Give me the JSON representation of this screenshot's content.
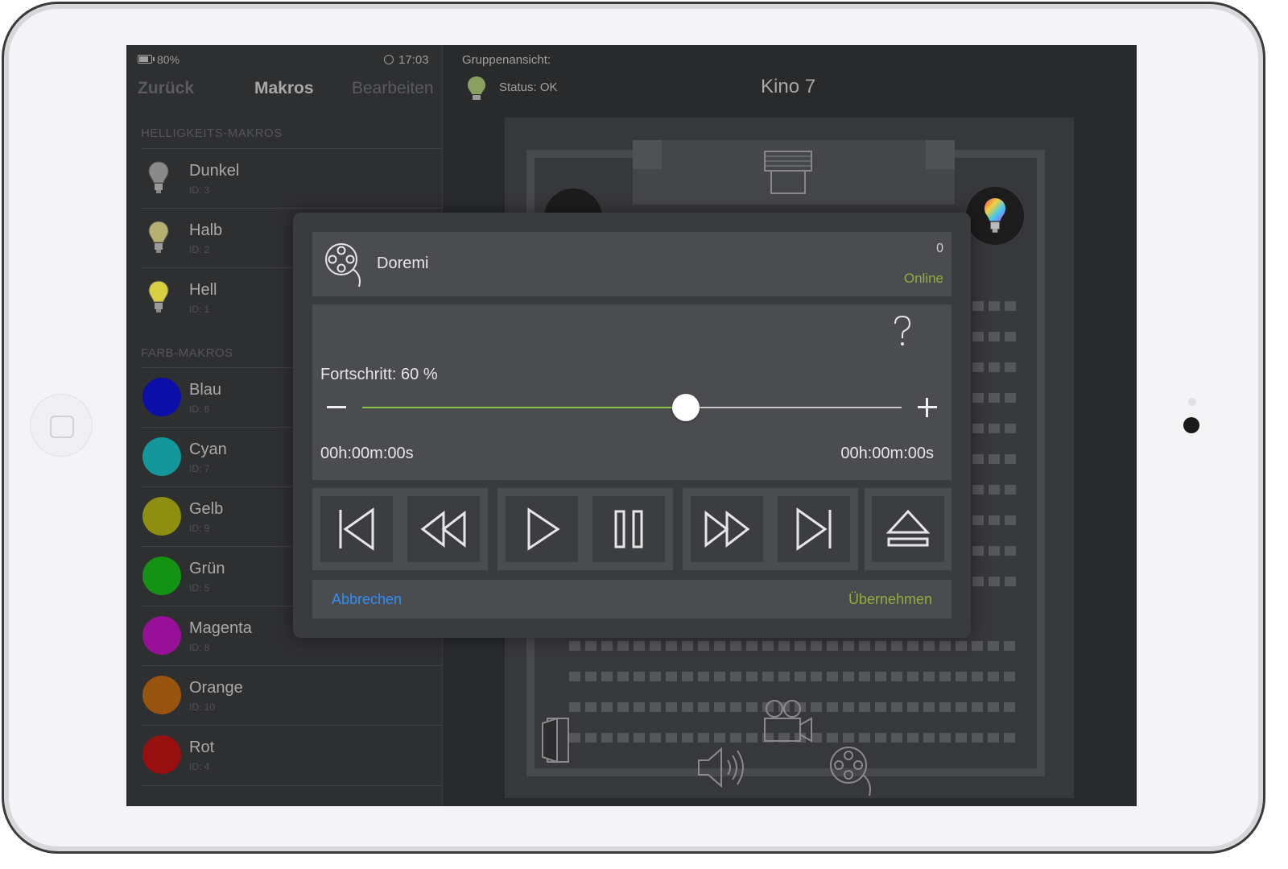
{
  "status_bar": {
    "battery": "80%",
    "time": "17:03"
  },
  "nav": {
    "back": "Zurück",
    "title": "Makros",
    "edit": "Bearbeiten"
  },
  "sections": {
    "brightness": "HELLIGKEITS-MAKROS",
    "color": "FARB-MAKROS"
  },
  "brightness_macros": [
    {
      "name": "Dunkel",
      "id": "ID: 3",
      "color": "#8a8a8a"
    },
    {
      "name": "Halb",
      "id": "ID: 2",
      "color": "#b8b070"
    },
    {
      "name": "Hell",
      "id": "ID: 1",
      "color": "#d8d040"
    }
  ],
  "color_macros": [
    {
      "name": "Blau",
      "id": "ID: 6",
      "color": "#0b0fa8"
    },
    {
      "name": "Cyan",
      "id": "ID: 7",
      "color": "#14979a"
    },
    {
      "name": "Gelb",
      "id": "ID: 9",
      "color": "#8e8e10"
    },
    {
      "name": "Grün",
      "id": "ID: 5",
      "color": "#139213"
    },
    {
      "name": "Magenta",
      "id": "ID: 8",
      "color": "#980f98"
    },
    {
      "name": "Orange",
      "id": "ID: 10",
      "color": "#98540f"
    },
    {
      "name": "Rot",
      "id": "ID: 4",
      "color": "#980f0f"
    }
  ],
  "group": {
    "label": "Gruppenansicht:",
    "status": "Status: OK",
    "room": "Kino 7"
  },
  "dialog": {
    "device_name": "Doremi",
    "device_count": "0",
    "device_state": "Online",
    "progress_label": "Fortschritt: 60 %",
    "progress_fraction": 0.6,
    "time_elapsed": "00h:00m:00s",
    "time_remaining": "00h:00m:00s",
    "controls": [
      "skip-back-icon",
      "rewind-icon",
      "play-icon",
      "pause-icon",
      "fast-forward-icon",
      "skip-forward-icon",
      "eject-icon"
    ],
    "cancel": "Abbrechen",
    "apply": "Übernehmen"
  },
  "colors": {
    "accent_blue": "#2f8ff7",
    "accent_green": "#8fae3c",
    "slider_fill": "#8bc34a"
  }
}
